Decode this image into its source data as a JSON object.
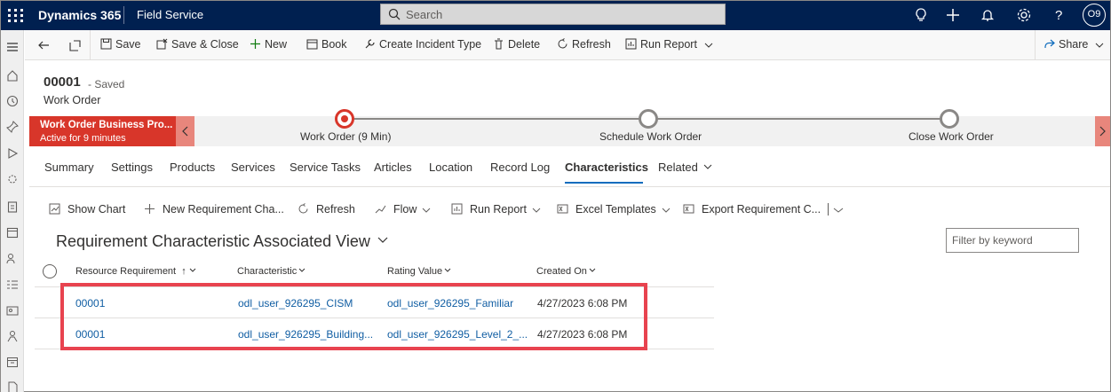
{
  "topbar": {
    "brand": "Dynamics 365",
    "app": "Field Service",
    "search_placeholder": "Search",
    "avatar": "O9"
  },
  "commandbar": {
    "save": "Save",
    "save_close": "Save & Close",
    "new": "New",
    "book": "Book",
    "create_incident_type": "Create Incident Type",
    "delete": "Delete",
    "refresh": "Refresh",
    "run_report": "Run Report",
    "share": "Share"
  },
  "header": {
    "record_id": "00001",
    "saved_status": "- Saved",
    "entity": "Work Order"
  },
  "bpf": {
    "active_name": "Work Order Business Pro...",
    "active_duration": "Active for 9 minutes",
    "stages": [
      "Work Order  (9 Min)",
      "Schedule Work Order",
      "Close Work Order"
    ]
  },
  "tabs": [
    "Summary",
    "Settings",
    "Products",
    "Services",
    "Service Tasks",
    "Articles",
    "Location",
    "Record Log",
    "Characteristics",
    "Related"
  ],
  "subgrid": {
    "commands": {
      "show_chart": "Show Chart",
      "new_req": "New Requirement Cha...",
      "refresh": "Refresh",
      "flow": "Flow",
      "run_report": "Run Report",
      "excel_templates": "Excel Templates",
      "export": "Export Requirement C..."
    },
    "view_title": "Requirement Characteristic Associated View",
    "filter_placeholder": "Filter by keyword",
    "columns": {
      "resource_requirement": "Resource Requirement",
      "characteristic": "Characteristic",
      "rating_value": "Rating Value",
      "created_on": "Created On"
    },
    "rows": [
      {
        "resource_requirement": "00001",
        "characteristic": "odl_user_926295_CISM",
        "rating_value": "odl_user_926295_Familiar",
        "created_on": "4/27/2023 6:08 PM"
      },
      {
        "resource_requirement": "00001",
        "characteristic": "odl_user_926295_Building...",
        "rating_value": "odl_user_926295_Level_2_...",
        "created_on": "4/27/2023 6:08 PM"
      }
    ]
  },
  "colors": {
    "topbar": "#002050",
    "bpf_active": "#d8362a",
    "link": "#115ea3",
    "highlight": "#e8434f"
  }
}
